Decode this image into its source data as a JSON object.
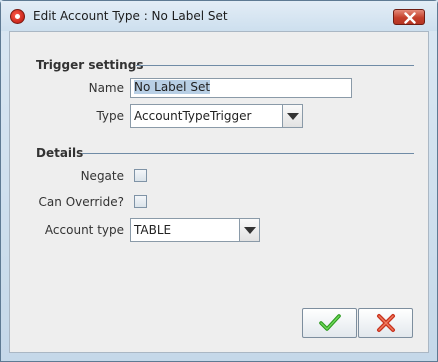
{
  "window": {
    "title": "Edit Account Type : No Label Set"
  },
  "trigger_settings": {
    "section_title": "Trigger settings",
    "name_label": "Name",
    "name_value": "No Label Set",
    "type_label": "Type",
    "type_value": "AccountTypeTrigger"
  },
  "details": {
    "section_title": "Details",
    "negate_label": "Negate",
    "negate_checked": false,
    "can_override_label": "Can Override?",
    "can_override_checked": false,
    "account_type_label": "Account type",
    "account_type_value": "TABLE"
  },
  "buttons": {
    "ok_icon": "checkmark-icon",
    "cancel_icon": "x-icon"
  }
}
